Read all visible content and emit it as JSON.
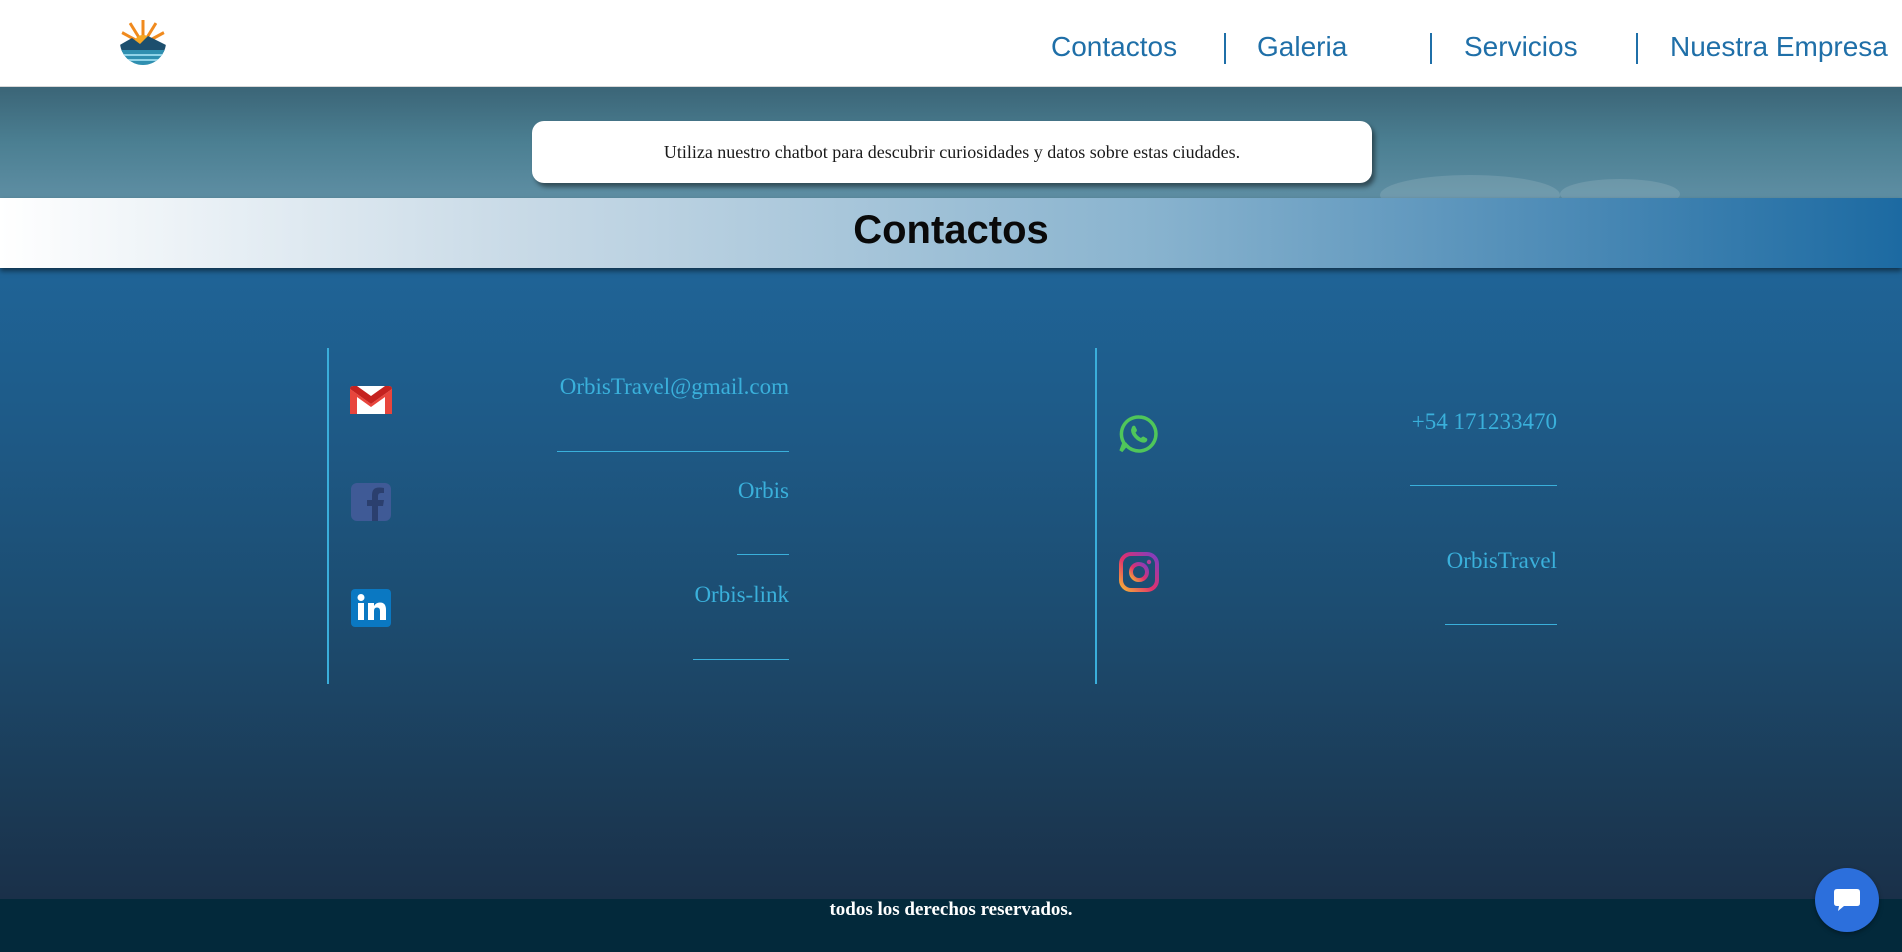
{
  "nav": {
    "items": [
      {
        "label": "Contactos"
      },
      {
        "label": "Galeria"
      },
      {
        "label": "Servicios"
      },
      {
        "label": "Nuestra Empresa"
      }
    ]
  },
  "hero": {
    "chatbot_text": "Utiliza nuestro chatbot para descubrir curiosidades y datos sobre estas ciudades."
  },
  "section": {
    "title": "Contactos"
  },
  "contacts": {
    "left": [
      {
        "icon": "gmail-icon",
        "text": "OrbisTravel@gmail.com"
      },
      {
        "icon": "facebook-icon",
        "text": "Orbis"
      },
      {
        "icon": "linkedin-icon",
        "text": "Orbis-link"
      }
    ],
    "right": [
      {
        "icon": "whatsapp-icon",
        "text": "+54 171233470"
      },
      {
        "icon": "instagram-icon",
        "text": "OrbisTravel"
      }
    ]
  },
  "footer": {
    "text": "todos los derechos reservados."
  },
  "colors": {
    "accent": "#1f6fa8",
    "link": "#3ab0db",
    "footer_bg": "#03293b",
    "chat_button": "#2c6fdc"
  }
}
